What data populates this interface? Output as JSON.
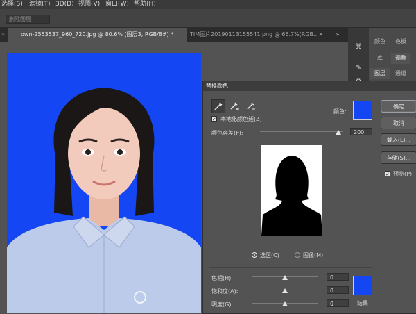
{
  "menu": {
    "items": [
      "选择(S)",
      "滤镜(T)",
      "3D(D)",
      "视图(V)",
      "窗口(W)",
      "帮助(H)"
    ]
  },
  "options_bar": {
    "field_value": "删除图层"
  },
  "tabs": [
    {
      "label": "own-2553537_960_720.jpg @ 80.6% (图层3, RGB/8#) *"
    },
    {
      "label": "TIM图片20190113155541.png @ 66.7%(RGB..."
    }
  ],
  "panels": {
    "row1": [
      "颜色",
      "色板"
    ],
    "row2": [
      "库",
      "调整"
    ],
    "row3": [
      "图层",
      "通道"
    ]
  },
  "dialog": {
    "title": "替换颜色",
    "localized_clusters_label": "本地化颜色簇(Z)",
    "localized_clusters_checked": true,
    "color_label": "颜色:",
    "fuzziness_label": "颜色容差(F):",
    "fuzziness_value": "200",
    "fuzziness_fraction": 0.94,
    "selection_radio": "选区(C)",
    "image_radio": "图像(M)",
    "selected_view": "selection",
    "hue_label": "色相(H):",
    "hue_value": "0",
    "saturation_label": "饱和度(A):",
    "saturation_value": "0",
    "lightness_label": "明度(G):",
    "lightness_value": "0",
    "result_label": "结果",
    "buttons": {
      "ok": "确定",
      "cancel": "取消",
      "load": "载入(L)...",
      "save": "存储(S)..."
    },
    "preview_label": "预览(P)",
    "preview_checked": true
  },
  "colors": {
    "replacement_blue": "#1446f3",
    "dialog_bg": "#535353",
    "app_bg": "#535353"
  },
  "icons": {
    "eyedropper": "eyedropper-icon",
    "eyedropper_plus": "eyedropper-plus-icon",
    "eyedropper_minus": "eyedropper-minus-icon"
  }
}
